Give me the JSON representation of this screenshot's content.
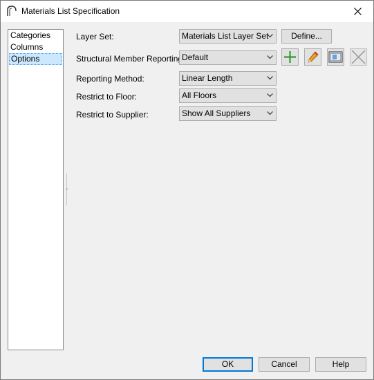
{
  "window": {
    "title": "Materials List Specification",
    "close_glyph": "✕"
  },
  "sidebar": {
    "items": [
      {
        "label": "Categories"
      },
      {
        "label": "Columns"
      },
      {
        "label": "Options",
        "selected": true
      }
    ]
  },
  "options": {
    "layer_set": {
      "label": "Layer Set:",
      "value": "Materials List Layer Set",
      "define_label": "Define..."
    },
    "structural_member_reporting": {
      "label": "Structural Member Reporting:",
      "value": "Default"
    },
    "reporting_method": {
      "label": "Reporting Method:",
      "value": "Linear Length"
    },
    "restrict_to_floor": {
      "label": "Restrict to Floor:",
      "value": "All Floors"
    },
    "restrict_to_supplier": {
      "label": "Restrict to Supplier:",
      "value": "Show All Suppliers"
    }
  },
  "toolbar_icons": [
    "add-icon",
    "pencil-icon",
    "copy-icon",
    "delete-icon"
  ],
  "footer": {
    "ok_label": "OK",
    "cancel_label": "Cancel",
    "help_label": "Help"
  },
  "colors": {
    "accent": "#0078d7",
    "selection": "#cce8ff",
    "add_green": "#2e9e2e"
  }
}
